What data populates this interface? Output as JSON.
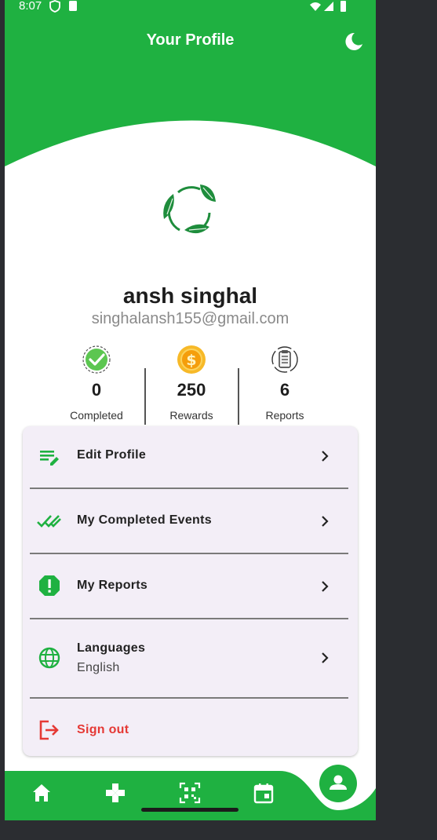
{
  "status_bar": {
    "time": "8:07"
  },
  "header": {
    "title": "Your Profile",
    "theme_icon": "moon-icon"
  },
  "colors": {
    "brand_green": "#1fb141",
    "danger_red": "#e53935",
    "card_bg": "#f3eef7"
  },
  "profile": {
    "name": "ansh singhal",
    "email": "singhalansh155@gmail.com"
  },
  "stats": [
    {
      "value": "0",
      "label": "Completed",
      "icon": "check-badge-icon"
    },
    {
      "value": "250",
      "label": "Rewards",
      "icon": "coin-icon"
    },
    {
      "value": "6",
      "label": "Reports",
      "icon": "clipboard-icon"
    }
  ],
  "menu": {
    "edit_profile": "Edit Profile",
    "completed_events": "My Completed Events",
    "reports": "My Reports",
    "languages": "Languages",
    "language_value": "English",
    "sign_out": "Sign out"
  },
  "bottom_nav": [
    "home-icon",
    "gamepad-icon",
    "qr-scan-icon",
    "calendar-icon",
    "profile-icon"
  ]
}
